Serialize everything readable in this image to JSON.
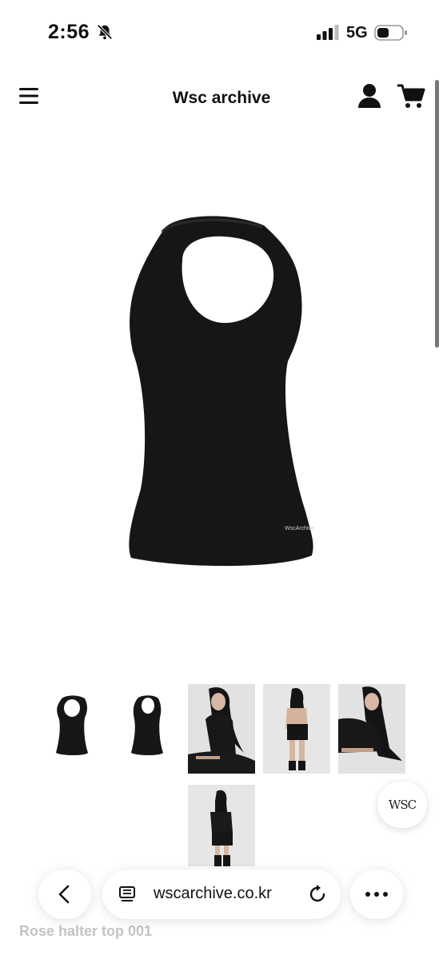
{
  "status_bar": {
    "time": "2:56",
    "network": "5G",
    "icons": [
      "bell-slash-icon",
      "signal-icon",
      "battery-icon"
    ]
  },
  "header": {
    "title": "Wsc archive",
    "icons": [
      "hamburger-menu-icon",
      "account-icon",
      "cart-icon"
    ]
  },
  "product": {
    "title": "Rose halter top 001",
    "main_image": "black halter top",
    "thumbnails": [
      "halter top front",
      "halter top back",
      "model seated",
      "model back view",
      "model lying",
      "model full outfit"
    ],
    "garment_label": "WscArchive"
  },
  "floating_button": {
    "label": "WSC"
  },
  "browser": {
    "url": "wscarchive.co.kr",
    "icons": [
      "back-chevron-icon",
      "page-icon",
      "reload-icon",
      "more-icon"
    ]
  },
  "colors": {
    "accent": "#111111",
    "background": "#ffffff"
  }
}
